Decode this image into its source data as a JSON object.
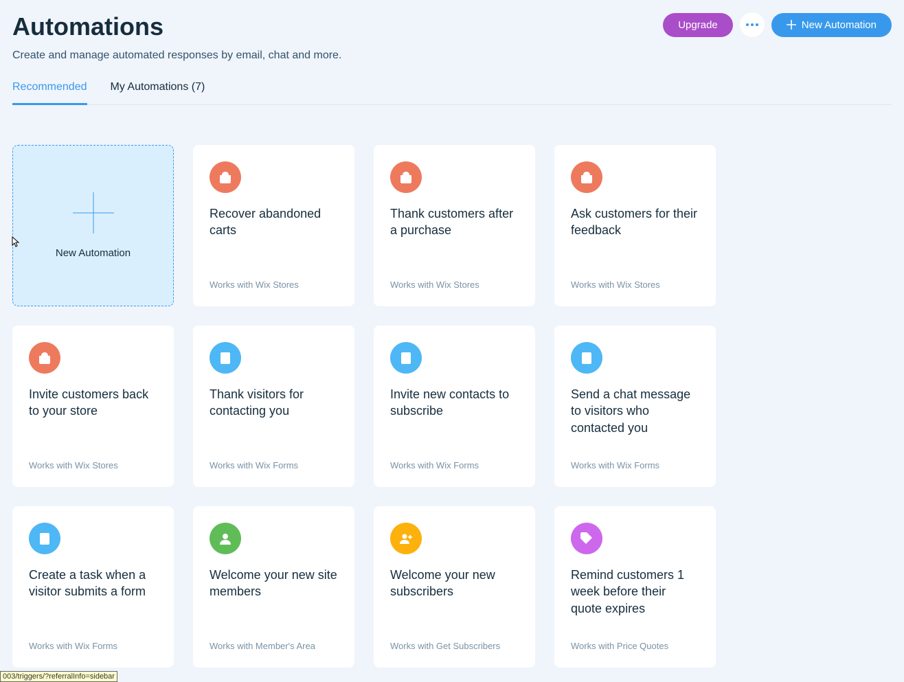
{
  "page": {
    "title": "Automations",
    "subtitle": "Create and manage automated responses by email, chat and more."
  },
  "header": {
    "upgrade_label": "Upgrade",
    "new_automation_label": "New Automation"
  },
  "tabs": {
    "recommended": "Recommended",
    "my_automations": "My Automations (7)"
  },
  "new_card_label": "New Automation",
  "cards": [
    {
      "icon": "bag",
      "color": "orange",
      "title": "Recover abandoned carts",
      "footer": "Works with Wix Stores"
    },
    {
      "icon": "bag",
      "color": "orange",
      "title": "Thank customers after a purchase",
      "footer": "Works with Wix Stores"
    },
    {
      "icon": "bag",
      "color": "orange",
      "title": "Ask customers for their feedback",
      "footer": "Works with Wix Stores"
    },
    {
      "icon": "bag",
      "color": "orange",
      "title": "Invite customers back to your store",
      "footer": "Works with Wix Stores"
    },
    {
      "icon": "form",
      "color": "blue",
      "title": "Thank visitors for contacting you",
      "footer": "Works with Wix Forms"
    },
    {
      "icon": "form",
      "color": "blue",
      "title": "Invite new contacts to subscribe",
      "footer": "Works with Wix Forms"
    },
    {
      "icon": "form",
      "color": "blue",
      "title": "Send a chat message to visitors who contacted you",
      "footer": "Works with Wix Forms"
    },
    {
      "icon": "form",
      "color": "blue",
      "title": "Create a task when a visitor submits a form",
      "footer": "Works with Wix Forms"
    },
    {
      "icon": "person",
      "color": "green",
      "title": "Welcome your new site members",
      "footer": "Works with Member's Area"
    },
    {
      "icon": "person-plus",
      "color": "yellow",
      "title": "Welcome your new subscribers",
      "footer": "Works with Get Subscribers"
    },
    {
      "icon": "tag",
      "color": "purple",
      "title": "Remind customers 1 week before their quote expires",
      "footer": "Works with Price Quotes"
    }
  ],
  "tooltip": "003/triggers/?referralInfo=sidebar"
}
